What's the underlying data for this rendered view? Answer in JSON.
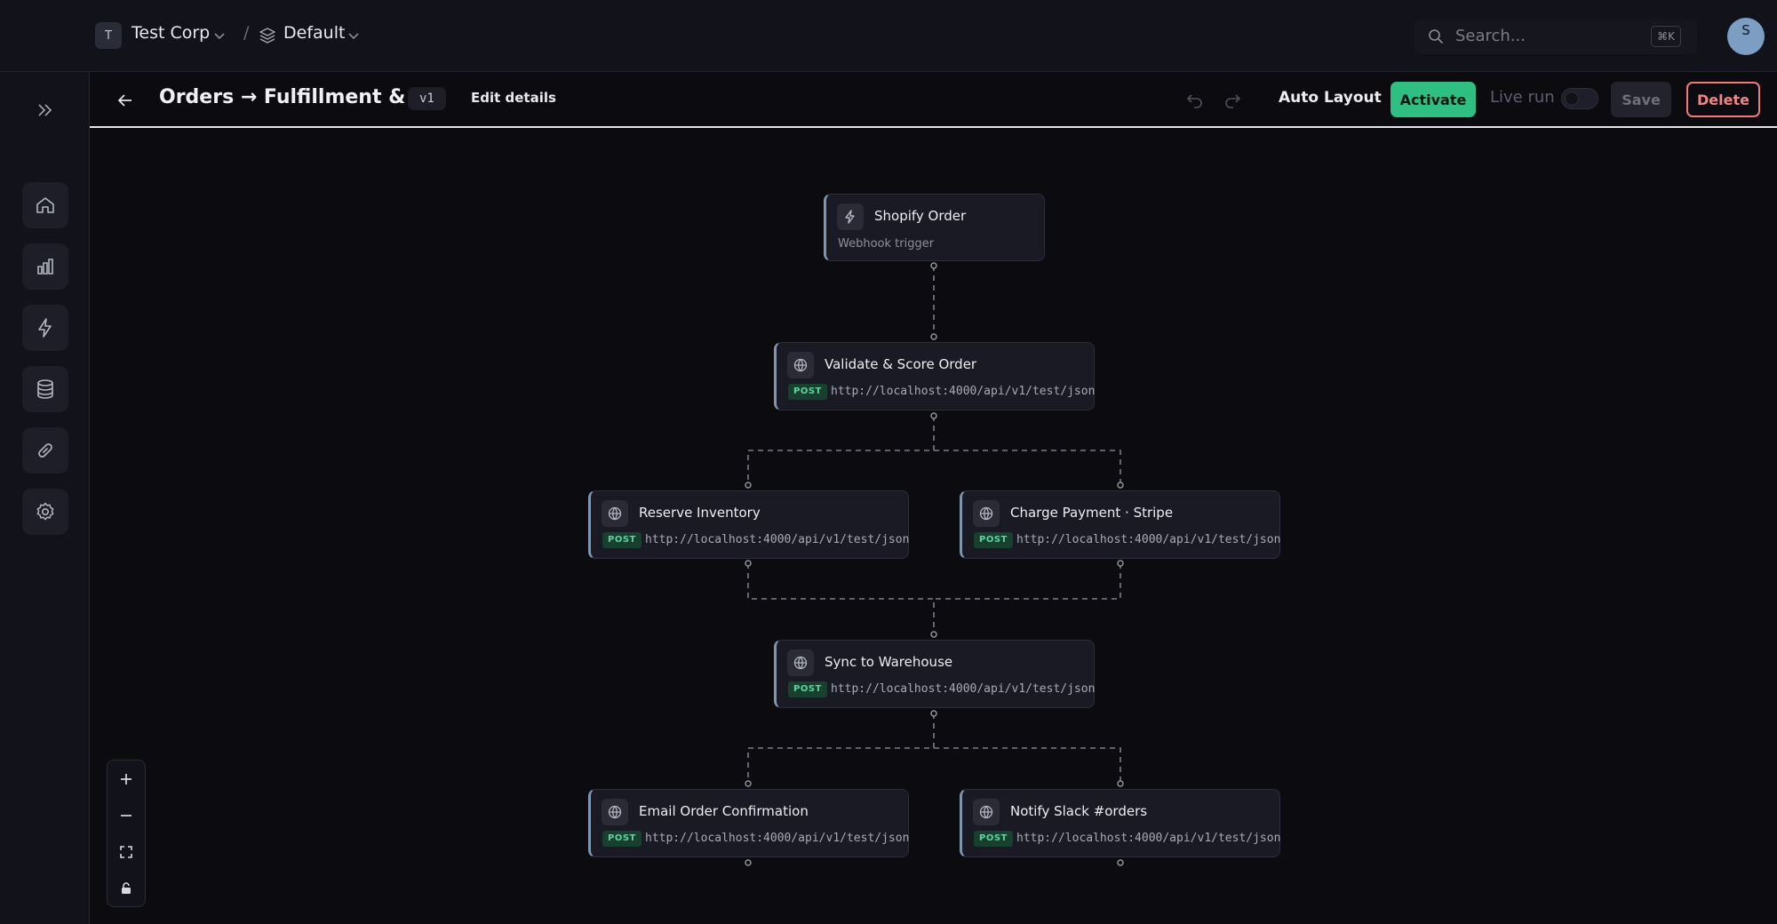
{
  "topbar": {
    "org_initial": "T",
    "org_name": "Test Corp",
    "separator": "/",
    "workspace": "Default",
    "search_placeholder": "Search...",
    "search_shortcut": "⌘K",
    "avatar_initial": "S"
  },
  "header": {
    "title": "Orders → Fulfillment & ...",
    "version": "v1",
    "edit_details": "Edit details",
    "auto_layout": "Auto Layout",
    "activate": "Activate",
    "live_run": "Live run",
    "save": "Save",
    "delete": "Delete"
  },
  "sidebar": {
    "items": [
      "home-icon",
      "analytics-icon",
      "triggers-icon",
      "database-icon",
      "connections-icon",
      "settings-icon"
    ]
  },
  "nodes": {
    "trigger": {
      "title": "Shopify Order",
      "subtitle": "Webhook trigger"
    },
    "validate": {
      "title": "Validate & Score Order",
      "method": "POST",
      "url": "http://localhost:4000/api/v1/test/json"
    },
    "reserve": {
      "title": "Reserve Inventory",
      "method": "POST",
      "url": "http://localhost:4000/api/v1/test/json"
    },
    "charge": {
      "title": "Charge Payment · Stripe",
      "method": "POST",
      "url": "http://localhost:4000/api/v1/test/json"
    },
    "sync": {
      "title": "Sync to Warehouse",
      "method": "POST",
      "url": "http://localhost:4000/api/v1/test/json"
    },
    "email": {
      "title": "Email Order Confirmation",
      "method": "POST",
      "url": "http://localhost:4000/api/v1/test/json"
    },
    "slack": {
      "title": "Notify Slack #orders",
      "method": "POST",
      "url": "http://localhost:4000/api/v1/test/json"
    }
  },
  "colors": {
    "accent": "#2fbf83",
    "danger": "#ef7a78",
    "node_border_accent": "#7f96b0"
  }
}
